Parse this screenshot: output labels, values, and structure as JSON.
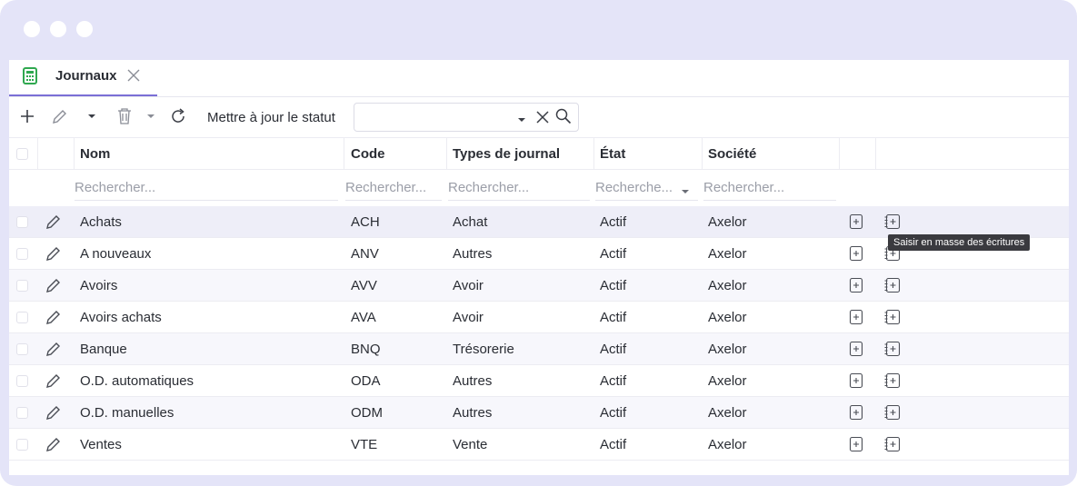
{
  "tab": {
    "label": "Journaux"
  },
  "toolbar": {
    "status_label": "Mettre à jour le statut",
    "status_value": ""
  },
  "columns": {
    "nom": "Nom",
    "code": "Code",
    "types": "Types de journal",
    "etat": "État",
    "societe": "Société"
  },
  "filters": {
    "nom": "Rechercher...",
    "code": "Rechercher...",
    "types": "Rechercher...",
    "etat": "Recherche...",
    "societe": "Rechercher..."
  },
  "rows": [
    {
      "nom": "Achats",
      "code": "ACH",
      "type": "Achat",
      "etat": "Actif",
      "societe": "Axelor"
    },
    {
      "nom": "A nouveaux",
      "code": "ANV",
      "type": "Autres",
      "etat": "Actif",
      "societe": "Axelor"
    },
    {
      "nom": "Avoirs",
      "code": "AVV",
      "type": "Avoir",
      "etat": "Actif",
      "societe": "Axelor"
    },
    {
      "nom": "Avoirs achats",
      "code": "AVA",
      "type": "Avoir",
      "etat": "Actif",
      "societe": "Axelor"
    },
    {
      "nom": "Banque",
      "code": "BNQ",
      "type": "Trésorerie",
      "etat": "Actif",
      "societe": "Axelor"
    },
    {
      "nom": "O.D. automatiques",
      "code": "ODA",
      "type": "Autres",
      "etat": "Actif",
      "societe": "Axelor"
    },
    {
      "nom": "O.D. manuelles",
      "code": "ODM",
      "type": "Autres",
      "etat": "Actif",
      "societe": "Axelor"
    },
    {
      "nom": "Ventes",
      "code": "VTE",
      "type": "Vente",
      "etat": "Actif",
      "societe": "Axelor"
    }
  ],
  "tooltip": {
    "text": "Saisir en masse des écritures"
  },
  "colors": {
    "frame": "#e4e4f8",
    "accent": "#7b6fd6",
    "tab_icon": "#2fa84f",
    "hover_row": "#eeeef8",
    "tooltip_bg": "#3a3a3f"
  },
  "icons": {
    "tab": "calculator-icon",
    "new": "plus-icon",
    "edit": "pencil-icon",
    "delete": "trash-icon",
    "refresh": "refresh-icon",
    "row_add": "plus-square-icon",
    "row_mass": "notebook-plus-icon"
  }
}
